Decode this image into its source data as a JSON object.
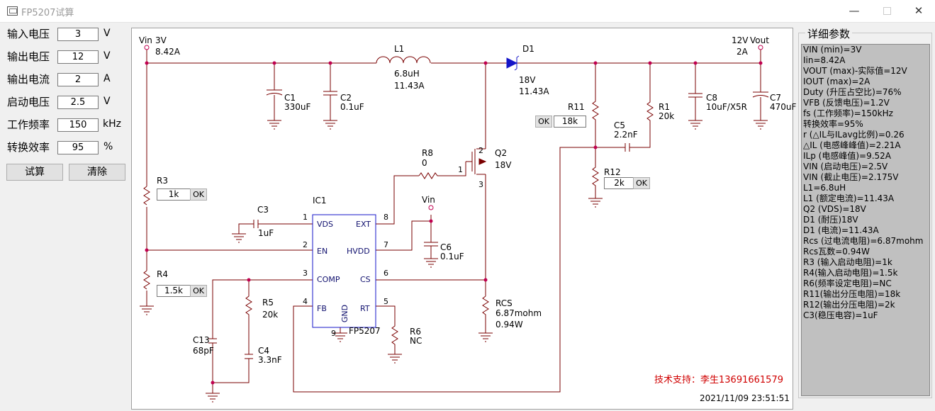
{
  "window": {
    "title": "FP5207试算",
    "min": "—",
    "close": "✕"
  },
  "params": [
    {
      "label": "输入电压",
      "value": "3",
      "unit": "V"
    },
    {
      "label": "输出电压",
      "value": "12",
      "unit": "V"
    },
    {
      "label": "输出电流",
      "value": "2",
      "unit": "A"
    },
    {
      "label": "启动电压",
      "value": "2.5",
      "unit": "V"
    },
    {
      "label": "工作频率",
      "value": "150",
      "unit": "kHz"
    },
    {
      "label": "转换效率",
      "value": "95",
      "unit": "%"
    }
  ],
  "buttons": {
    "calc": "试算",
    "clear": "清除",
    "ok": "OK"
  },
  "schematic": {
    "vin_label": "Vin",
    "vin_value": "3V",
    "vin_current": "8.42A",
    "vout_value": "12V",
    "vout_label": "Vout",
    "vout_current": "2A",
    "l1": {
      "name": "L1",
      "value": "6.8uH",
      "current": "11.43A"
    },
    "d1": {
      "name": "D1",
      "voltage": "18V",
      "current": "11.43A"
    },
    "c1": {
      "name": "C1",
      "value": "330uF"
    },
    "c2": {
      "name": "C2",
      "value": "0.1uF"
    },
    "c8": {
      "name": "C8",
      "value": "10uF/X5R"
    },
    "c7": {
      "name": "C7",
      "value": "470uF"
    },
    "r11": {
      "name": "R11",
      "value": "18k"
    },
    "r1": {
      "name": "R1",
      "value": "20k"
    },
    "c5": {
      "name": "C5",
      "value": "2.2nF"
    },
    "r12": {
      "name": "R12",
      "value": "2k"
    },
    "r8": {
      "name": "R8",
      "value": "0"
    },
    "q2": {
      "name": "Q2",
      "value": "18V",
      "pin1": "1",
      "pin2": "2",
      "pin3": "3"
    },
    "r3": {
      "name": "R3",
      "value": "1k"
    },
    "c3": {
      "name": "C3",
      "value": "1uF"
    },
    "ic1": {
      "name": "IC1",
      "part": "FP5207",
      "pins": {
        "vds": "VDS",
        "en": "EN",
        "comp": "COMP",
        "fb": "FB",
        "gnd": "GND",
        "rt": "RT",
        "cs": "CS",
        "hvdd": "HVDD",
        "ext": "EXT"
      },
      "pin_numbers": {
        "p1": "1",
        "p2": "2",
        "p3": "3",
        "p4": "4",
        "p5": "5",
        "p6": "6",
        "p7": "7",
        "p8": "8",
        "p9": "9"
      }
    },
    "vin_hvdd": "Vin",
    "c6": {
      "name": "C6",
      "value": "0.1uF"
    },
    "r4": {
      "name": "R4",
      "value": "1.5k"
    },
    "r5": {
      "name": "R5",
      "value": "20k"
    },
    "c13": {
      "name": "C13",
      "value": "68pF"
    },
    "c4": {
      "name": "C4",
      "value": "3.3nF"
    },
    "r6": {
      "name": "R6",
      "value": "NC"
    },
    "rcs": {
      "name": "RCS",
      "value": "6.87mohm",
      "power": "0.94W"
    },
    "support": "技术支持：李生13691661579",
    "timestamp": "2021/11/09 23:51:51"
  },
  "details": {
    "title": "详细参数",
    "lines": [
      "VIN (min)=3V",
      "Iin=8.42A",
      "VOUT (max)-实际值=12V",
      "IOUT (max)=2A",
      "Duty (升压占空比)=76%",
      "VFB (反馈电压)=1.2V",
      "fs (工作频率)=150kHz",
      "转换效率=95%",
      "r (△IL与ILavg比例)=0.26",
      "△IL (电感峰峰值)=2.21A",
      "ILp (电感峰值)=9.52A",
      "VIN (启动电压)=2.5V",
      "VIN (截止电压)=2.175V",
      "L1=6.8uH",
      "L1 (额定电流)=11.43A",
      "Q2 (VDS)=18V",
      "D1 (耐压)18V",
      "D1 (电流)=11.43A",
      "Rcs (过电流电阻)=6.87mohm",
      "Rcs瓦数=0.94W",
      "R3 (输入启动电阻)=1k",
      "R4(输入启动电阻)=1.5k",
      "R6(频率设定电阻)=NC",
      "R11(输出分压电阻)=18k",
      "R12(输出分压电阻)=2k",
      "C3(稳压电容)=1uF"
    ]
  }
}
